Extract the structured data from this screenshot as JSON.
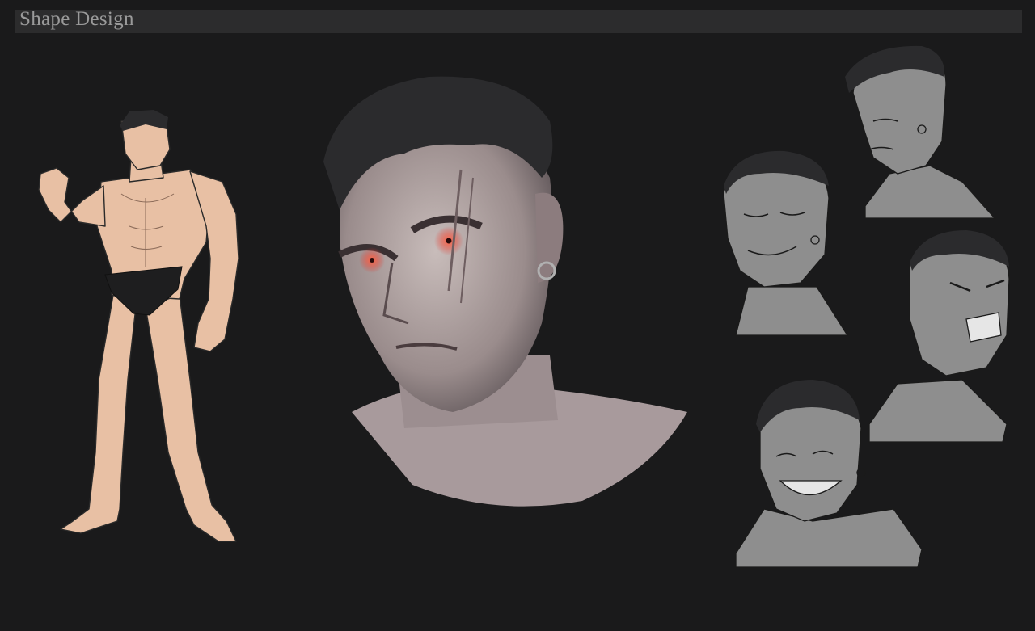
{
  "header": {
    "title": "Shape Design"
  },
  "colors": {
    "background": "#1a1a1b",
    "header_bar": "#2c2c2d",
    "title_text": "#9a9a9a",
    "skin": "#e8c0a4",
    "lineart": "#2a2a2a",
    "sketch_gray": "#8e8e8e",
    "hair": "#2b2b2d",
    "eye_glow": "#e0302a"
  },
  "figures": [
    {
      "name": "full-body-figure",
      "style": "flat color"
    },
    {
      "name": "painted-head-portrait",
      "style": "painted"
    },
    {
      "name": "expression-sketch",
      "expression": "profile-neutral"
    },
    {
      "name": "expression-sketch",
      "expression": "smug-eyes-closed"
    },
    {
      "name": "expression-sketch",
      "expression": "angry-shouting"
    },
    {
      "name": "expression-sketch",
      "expression": "laughing"
    }
  ]
}
